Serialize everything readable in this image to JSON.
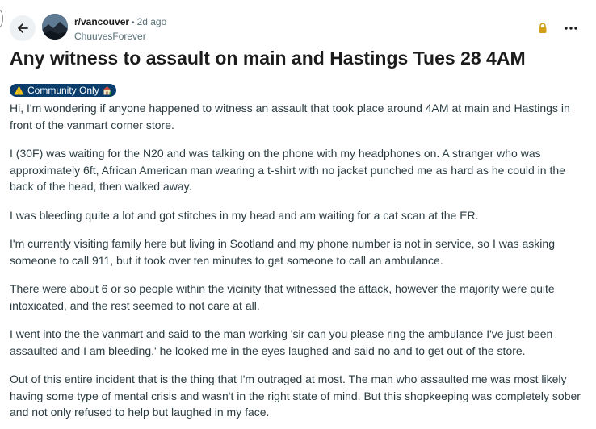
{
  "post": {
    "subreddit": "r/vancouver",
    "separator": "•",
    "time_ago": "2d ago",
    "author": "ChuuvesForever",
    "title": "Any witness to assault on main and Hastings Tues 28 4AM",
    "flair": "Community Only",
    "paragraphs": [
      "Hi, I'm wondering if anyone happened to witness an assault that took place around 4AM at main and Hastings in front of the vanmart corner store.",
      "I (30F) was waiting for the N20 and was talking on the phone with my headphones on. A stranger who was approximately 6ft, African American man wearing a t-shirt with no jacket punched me as hard as he could in the back of the head, then walked away.",
      "I was bleeding quite a lot and got stitches in my head and am waiting for a cat scan at the ER.",
      "I'm currently visiting family here but living in Scotland and my phone number is not in service, so I was asking someone to call 911, but it took over ten minutes to get someone to call an ambulance.",
      "There were about 6 or so people within the vicinity that witnessed the attack, however the majority were quite intoxicated, and the rest seemed to not care at all.",
      "I went into the the vanmart and said to the man working 'sir can you please ring the ambulance I've just been assaulted and I am bleeding.' he looked me in the eyes laughed and said no and to get out of the store.",
      "Out of this entire incident that is the thing that I'm outraged at most. The man who assaulted me was most likely having some type of mental crisis and wasn't in the right state of mind. But this shopkeeping was completely sober and not only refused to help but laughed in my face."
    ]
  },
  "icons": {
    "back": "arrow-left-icon",
    "lock": "lock-icon",
    "more": "more-horizontal-icon",
    "flair_left": "warning-icon",
    "flair_right": "house-icon"
  },
  "colors": {
    "flair_bg": "#0a3d6b",
    "lock": "#d4a017",
    "back_bg": "#eef1f3"
  }
}
